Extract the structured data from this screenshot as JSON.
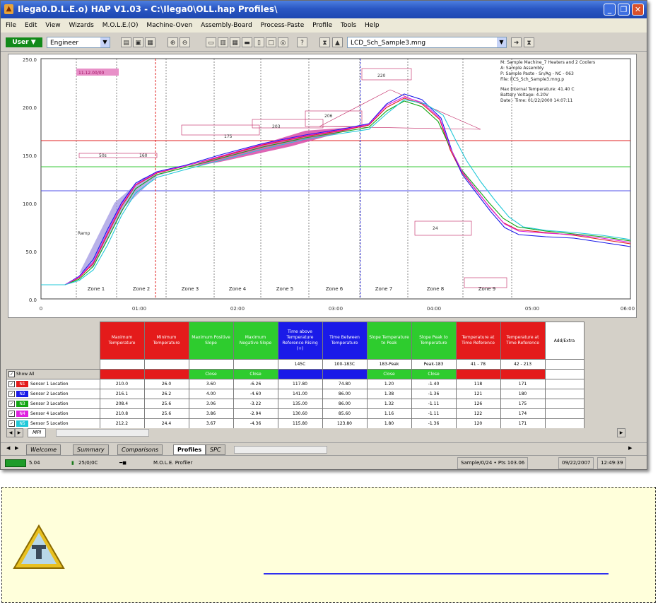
{
  "window": {
    "title": "Ilega0.D.L.E.o) HAP V1.03 - C:\\Ilega0\\OLL.hap Profiles\\",
    "controls": {
      "minimize": "_",
      "restore": "❐",
      "close": "✕"
    }
  },
  "menu": [
    "File",
    "Edit",
    "View",
    "Wizards",
    "M.O.L.E.(O)",
    "Machine-Oven",
    "Assembly-Board",
    "Process-Paste",
    "Profile",
    "Tools",
    "Help"
  ],
  "toolbar": {
    "user_button": "User ▼",
    "user_select": "Engineer",
    "file_select": "LCD_Sch_Sample3.mng"
  },
  "graph": {
    "y_ticks": [
      "250.0",
      "200.0",
      "150.0",
      "100.0",
      "50.0",
      "0.0"
    ],
    "x_ticks": [
      "0",
      "01:00",
      "02:00",
      "03:00",
      "04:00",
      "05:00",
      "06:00"
    ],
    "highlight_label": "11.12.00/00",
    "info_lines": [
      "M: Sample Machine_7 Heaters and 2 Coolers",
      "A: Sample Assembly",
      "P: Sample Paste - Sn/Ag - NC - 063",
      "File: ECS_Sch_Sample3.mng.p",
      "",
      "Max Internal Temperature: 41.40 C",
      "Battery Voltage: 4.20V",
      "Date - Time: 01/22/2000 14:07:11"
    ],
    "zones": [
      "Zone 1",
      "Zone 2",
      "Zone 3",
      "Zone 4",
      "Zone 5",
      "Zone 6",
      "Zone 7",
      "Zone 8",
      "Zone 9"
    ],
    "ramp_label": "Ramp",
    "spec_labels": [
      "50s",
      "160",
      "175",
      "203",
      "206",
      "220",
      "24"
    ]
  },
  "stats_table": {
    "headers": [
      {
        "text": "Maximum Temperature",
        "color": "#e41b1b"
      },
      {
        "text": "Minimum Temperature",
        "color": "#e41b1b"
      },
      {
        "text": "Maximum Positive Slope",
        "color": "#2ecc2e"
      },
      {
        "text": "Maximum Negative Slope",
        "color": "#2ecc2e"
      },
      {
        "text": "Time above Temperature Reference Rising (+)",
        "color": "#1a1ae8"
      },
      {
        "text": "Time Between Temperature",
        "color": "#1a1ae8"
      },
      {
        "text": "Slope Temperature to Peak",
        "color": "#2ecc2e"
      },
      {
        "text": "Slope Peak to Temperature",
        "color": "#2ecc2e"
      },
      {
        "text": "Temperature at Time Reference",
        "color": "#e41b1b"
      },
      {
        "text": "Temperature at Time Reference",
        "color": "#e41b1b"
      }
    ],
    "add_extra": "Add/Extra",
    "params": [
      "",
      "",
      "",
      "",
      "145C",
      "100-183C",
      "183-Peak",
      "Peak-183",
      "41 - 78",
      "42 - 213"
    ],
    "show_all": "Show All",
    "status_row": [
      {
        "text": "",
        "color": "#e41b1b"
      },
      {
        "text": "",
        "color": "#e41b1b"
      },
      {
        "text": "Close",
        "color": "#2ecc2e"
      },
      {
        "text": "Close",
        "color": "#2ecc2e"
      },
      {
        "text": "",
        "color": "#1a1ae8"
      },
      {
        "text": "",
        "color": "#1a1ae8"
      },
      {
        "text": "Close",
        "color": "#2ecc2e"
      },
      {
        "text": "Close",
        "color": "#2ecc2e"
      },
      {
        "text": "",
        "color": "#e41b1b"
      },
      {
        "text": "",
        "color": "#e41b1b"
      }
    ],
    "rows": [
      {
        "id": "N1",
        "color": "#e41b1b",
        "name": "Sensor 1 Location",
        "values": [
          "210.0",
          "26.0",
          "3.60",
          "-6.26",
          "117.80",
          "74.80",
          "1.20",
          "-1.40",
          "118",
          "171"
        ]
      },
      {
        "id": "N2",
        "color": "#1a1ae8",
        "name": "Sensor 2 Location",
        "values": [
          "216.1",
          "26.2",
          "4.00",
          "-4.60",
          "141.00",
          "86.00",
          "1.38",
          "-1.36",
          "121",
          "180"
        ]
      },
      {
        "id": "N3",
        "color": "#11a611",
        "name": "Sensor 3 Location",
        "values": [
          "208.4",
          "25.6",
          "3.06",
          "-3.22",
          "135.00",
          "86.00",
          "1.32",
          "-1.11",
          "126",
          "175"
        ]
      },
      {
        "id": "N4",
        "color": "#e020e0",
        "name": "Sensor 4 Location",
        "values": [
          "210.8",
          "25.6",
          "3.86",
          "-2.94",
          "130.60",
          "85.60",
          "1.16",
          "-1.11",
          "122",
          "174"
        ]
      },
      {
        "id": "N5",
        "color": "#20c8d8",
        "name": "Sensor 5 Location",
        "values": [
          "212.2",
          "24.4",
          "3.67",
          "-4.36",
          "115.80",
          "123.80",
          "1.80",
          "-1.36",
          "120",
          "171"
        ]
      }
    ]
  },
  "sheet_tab": "MPI",
  "view_tabs": [
    "Welcome",
    "Summary",
    "Comparisons",
    "Profiles",
    "SPC"
  ],
  "active_view_tab": "Profiles",
  "status": {
    "battery": "5.04",
    "voltage": "25/0/0C",
    "device": "M.O.L.E. Profiler",
    "record": "Sample/0/24 • Pts 103.06",
    "date": "09/22/2007",
    "time": "12:49:39"
  }
}
